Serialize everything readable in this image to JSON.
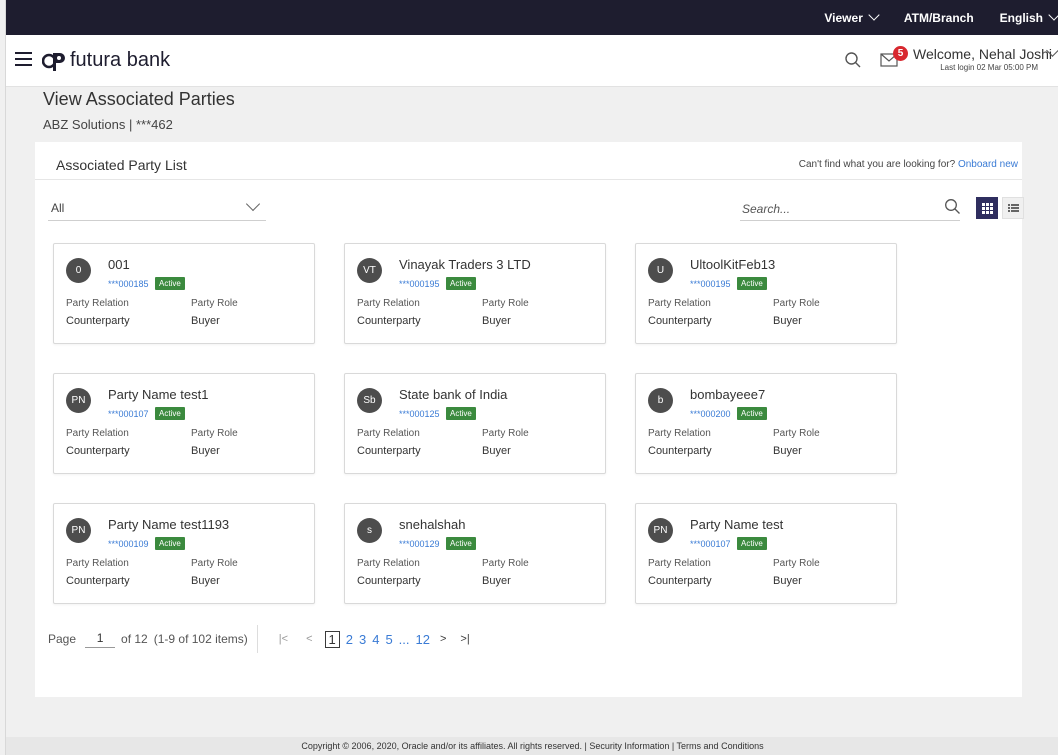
{
  "topbar": {
    "viewer": "Viewer",
    "branch": "ATM/Branch",
    "language": "English"
  },
  "header": {
    "brand": "futura bank",
    "mail_count": "5",
    "welcome": "Welcome, Nehal Joshi",
    "last_login": "Last login 02 Mar 05:00 PM"
  },
  "page": {
    "title": "View Associated Parties",
    "subtitle": "ABZ Solutions | ***462"
  },
  "panel": {
    "title": "Associated Party List",
    "onboard_prompt": "Can't find what you are looking for?",
    "onboard_link": "Onboard new",
    "filter_value": "All",
    "search_placeholder": "Search..."
  },
  "labels": {
    "relation": "Party Relation",
    "role": "Party Role"
  },
  "cards": [
    {
      "initials": "0",
      "name": "001",
      "account": "***000185",
      "status": "Active",
      "relation": "Counterparty",
      "role": "Buyer"
    },
    {
      "initials": "VT",
      "name": "Vinayak Traders 3 LTD",
      "account": "***000195",
      "status": "Active",
      "relation": "Counterparty",
      "role": "Buyer"
    },
    {
      "initials": "U",
      "name": "UltoolKitFeb13",
      "account": "***000195",
      "status": "Active",
      "relation": "Counterparty",
      "role": "Buyer"
    },
    {
      "initials": "PN",
      "name": "Party Name test1",
      "account": "***000107",
      "status": "Active",
      "relation": "Counterparty",
      "role": "Buyer"
    },
    {
      "initials": "Sb",
      "name": "State bank of India",
      "account": "***000125",
      "status": "Active",
      "relation": "Counterparty",
      "role": "Buyer"
    },
    {
      "initials": "b",
      "name": "bombayeee7",
      "account": "***000200",
      "status": "Active",
      "relation": "Counterparty",
      "role": "Buyer"
    },
    {
      "initials": "PN",
      "name": "Party Name test1193",
      "account": "***000109",
      "status": "Active",
      "relation": "Counterparty",
      "role": "Buyer"
    },
    {
      "initials": "s",
      "name": "snehalshah",
      "account": "***000129",
      "status": "Active",
      "relation": "Counterparty",
      "role": "Buyer"
    },
    {
      "initials": "PN",
      "name": "Party Name test",
      "account": "***000107",
      "status": "Active",
      "relation": "Counterparty",
      "role": "Buyer"
    }
  ],
  "pager": {
    "page_label": "Page",
    "current": "1",
    "of_label": "of 12",
    "items_label": "(1-9 of 102 items)",
    "pages": [
      "1",
      "2",
      "3",
      "4",
      "5",
      "...",
      "12"
    ]
  },
  "footer": {
    "text": "Copyright © 2006, 2020, Oracle and/or its affiliates. All rights reserved. | Security Information | Terms and Conditions"
  },
  "colors": {
    "topbar": "#1e1d2f",
    "link": "#3a7bd5",
    "active_badge": "#3b8a3e",
    "mail_badge": "#d8282f",
    "avatar": "#4d4d4d"
  }
}
